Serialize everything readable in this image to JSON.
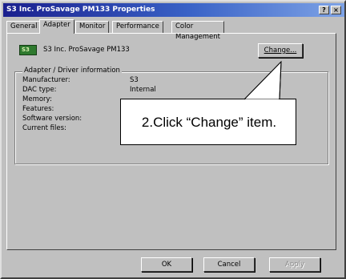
{
  "window": {
    "title": "S3 Inc. ProSavage PM133 Properties",
    "help_icon": "?",
    "close_icon": "×"
  },
  "tabs": [
    {
      "label": "General"
    },
    {
      "label": "Adapter",
      "active": true
    },
    {
      "label": "Monitor"
    },
    {
      "label": "Performance"
    },
    {
      "label": "Color Management"
    }
  ],
  "adapter": {
    "logo_text": "S3",
    "name": "S3 Inc. ProSavage PM133",
    "change_label": "Change..."
  },
  "info": {
    "group_title": "Adapter / Driver information",
    "rows": [
      {
        "label": "Manufacturer:",
        "value": "S3"
      },
      {
        "label": "DAC type:",
        "value": "Internal"
      },
      {
        "label": "Memory:",
        "value": ""
      },
      {
        "label": "Features:",
        "value": ""
      },
      {
        "label": "Software version:",
        "value": ""
      },
      {
        "label": "Current files:",
        "value": ""
      }
    ]
  },
  "callout": {
    "text": "2.Click “Change” item."
  },
  "footer": {
    "ok_label": "OK",
    "cancel_label": "Cancel",
    "apply_label": "Apply"
  },
  "colors": {
    "titlebar_start": "#1a1f8e",
    "titlebar_end": "#7ea3e6",
    "face": "#c0c0c0",
    "logo_green": "#2f7a2f"
  }
}
